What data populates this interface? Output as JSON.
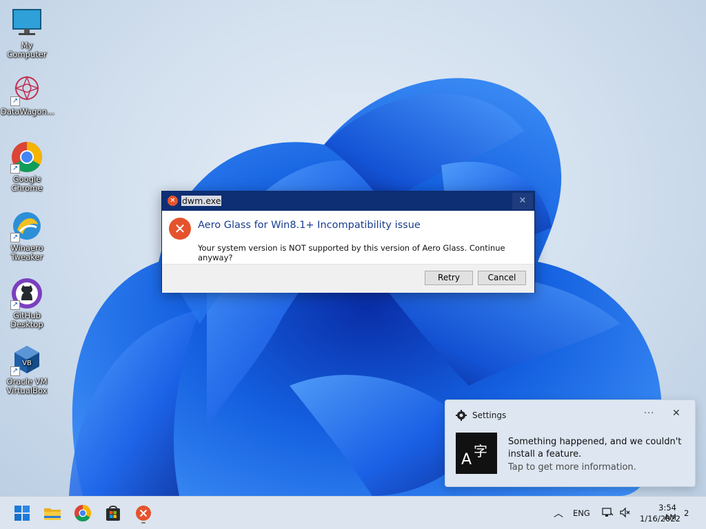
{
  "desktop": {
    "icons": [
      {
        "label": "My Computer"
      },
      {
        "label": "DataWagon..."
      },
      {
        "label": "Google Chrome"
      },
      {
        "label": "Winaero Tweaker"
      },
      {
        "label": "GitHub Desktop"
      },
      {
        "label": "Oracle VM VirtualBox"
      }
    ]
  },
  "dialog": {
    "title": "dwm.exe",
    "heading": "Aero Glass for Win8.1+ Incompatibility issue",
    "message": "Your system version is NOT supported by this version of Aero Glass. Continue anyway?",
    "retry_label": "Retry",
    "cancel_label": "Cancel",
    "icon": "error-icon",
    "accent": "#e5532d"
  },
  "toast": {
    "app": "Settings",
    "app_icon": "gear-icon",
    "more": "···",
    "close": "✕",
    "line1": "Something happened, and we couldn't",
    "line2": "install a feature.",
    "line3": "Tap to get more information.",
    "image_icon": "language-icon"
  },
  "taskbar": {
    "apps": [
      {
        "name": "start-icon"
      },
      {
        "name": "file-explorer-icon"
      },
      {
        "name": "chrome-icon"
      },
      {
        "name": "store-icon"
      },
      {
        "name": "error-app-icon"
      }
    ],
    "language": "ENG",
    "time": "3:54 AM",
    "date": "1/16/2022",
    "notification_count": "2"
  }
}
